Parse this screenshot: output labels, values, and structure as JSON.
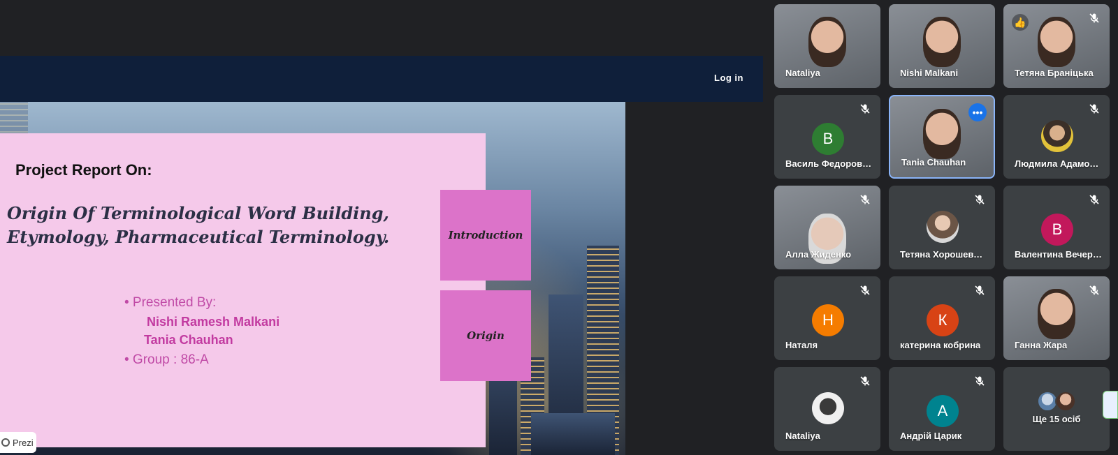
{
  "share": {
    "login_label": "Log in",
    "badge_label": "Prezi"
  },
  "slide": {
    "heading": "Project Report On:",
    "title_lines": [
      "Origin Of Terminological Word Building,",
      "Etymology, Pharmaceutical Terminology."
    ],
    "presented_label": "• Presented By:",
    "presenters": [
      "Nishi Ramesh Malkani",
      "Tania Chauhan"
    ],
    "group_label": "•  Group : 86-A",
    "side_boxes": [
      "Introduction",
      "Origin"
    ]
  },
  "participants": [
    {
      "name": "Nataliya"
    },
    {
      "name": "Nishi Malkani"
    },
    {
      "name": "Тетяна Браніцька",
      "reaction": "👍"
    },
    {
      "name": "Василь Федорович",
      "initial": "В",
      "color": "#2e7d32"
    },
    {
      "name": "Tania Chauhan",
      "more": "•••"
    },
    {
      "name": "Людмила Адамович"
    },
    {
      "name": "Алла Жиденко"
    },
    {
      "name": "Тетяна Хорошевська"
    },
    {
      "name": "Валентина Вечерська",
      "initial": "В",
      "color": "#c2185b"
    },
    {
      "name": "Наталя",
      "initial": "Н",
      "color": "#f57c00"
    },
    {
      "name": "катерина кобрина",
      "initial": "К",
      "color": "#d84315"
    },
    {
      "name": "Ганна Жара"
    },
    {
      "name": "Nataliya"
    },
    {
      "name": "Андрій Царик",
      "initial": "А",
      "color": "#00838f"
    }
  ],
  "overflow_tile": {
    "label": "Ще 15 осіб"
  },
  "icons": {
    "mic_off": "mic-off-icon",
    "more": "more-options-icon",
    "reaction": "thumbs-up-icon",
    "logo": "prezi-logo-icon"
  }
}
